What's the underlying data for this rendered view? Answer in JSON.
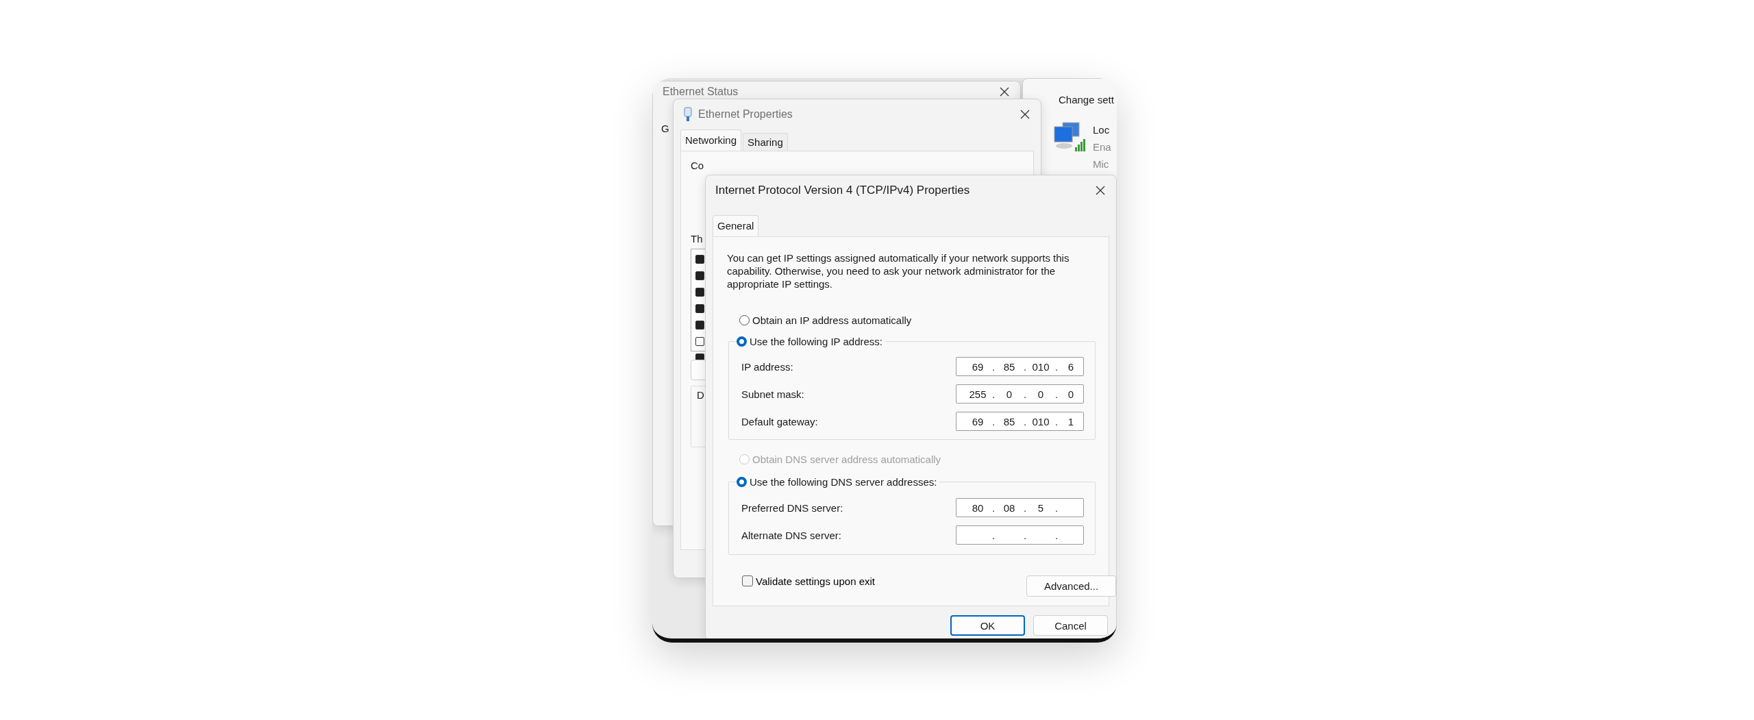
{
  "status_window": {
    "title": "Ethernet Status",
    "fragment": "G"
  },
  "properties_window": {
    "title": "Ethernet Properties",
    "tabs": [
      {
        "label": "Networking",
        "selected": true
      },
      {
        "label": "Sharing",
        "selected": false
      }
    ],
    "connect_label": "Co",
    "list_label": "Th",
    "components": [
      {
        "checked": true
      },
      {
        "checked": true
      },
      {
        "checked": true
      },
      {
        "checked": true
      },
      {
        "checked": true
      },
      {
        "checked": false
      },
      {
        "checked": true
      }
    ],
    "group_label": "D"
  },
  "connections_window": {
    "toolbar_text": "Change sett",
    "adapter": {
      "name": "Loc",
      "status": "Ena",
      "device": "Mic"
    }
  },
  "dialog": {
    "title": "Internet Protocol Version 4 (TCP/IPv4) Properties",
    "tabs": [
      {
        "label": "General",
        "selected": true
      }
    ],
    "intro": "You can get IP settings assigned automatically if your network supports this capability. Otherwise, you need to ask your network administrator for the appropriate IP settings.",
    "ip_options": [
      {
        "label": "Obtain an IP address automatically",
        "selected": false,
        "disabled": false
      },
      {
        "label": "Use the following IP address:",
        "selected": true,
        "disabled": false
      }
    ],
    "ip_fields": [
      {
        "label": "IP address:",
        "octets": [
          "69",
          "85",
          "010",
          "6"
        ],
        "dots": [
          ".",
          ".",
          "."
        ]
      },
      {
        "label": "Subnet mask:",
        "octets": [
          "255",
          "0",
          "0",
          "0"
        ],
        "dots": [
          ".",
          ".",
          "."
        ]
      },
      {
        "label": "Default gateway:",
        "octets": [
          "69",
          "85",
          "010",
          "1"
        ],
        "dots": [
          ".",
          ".",
          "."
        ]
      }
    ],
    "dns_options": [
      {
        "label": "Obtain DNS server address automatically",
        "selected": false,
        "disabled": true
      },
      {
        "label": "Use the following DNS server addresses:",
        "selected": true,
        "disabled": false
      }
    ],
    "dns_fields": [
      {
        "label": "Preferred DNS server:",
        "octets": [
          "80",
          "08",
          "5"
        ],
        "dots": [
          ".",
          ".",
          "."
        ]
      },
      {
        "label": "Alternate DNS server:",
        "dots": [
          ".",
          ".",
          "."
        ]
      }
    ],
    "validate": {
      "label": "Validate settings upon exit",
      "checked": false
    },
    "advanced_button": "Advanced...",
    "buttons": [
      {
        "label": "OK",
        "kind": "default"
      },
      {
        "label": "Cancel",
        "kind": "normal"
      }
    ]
  }
}
